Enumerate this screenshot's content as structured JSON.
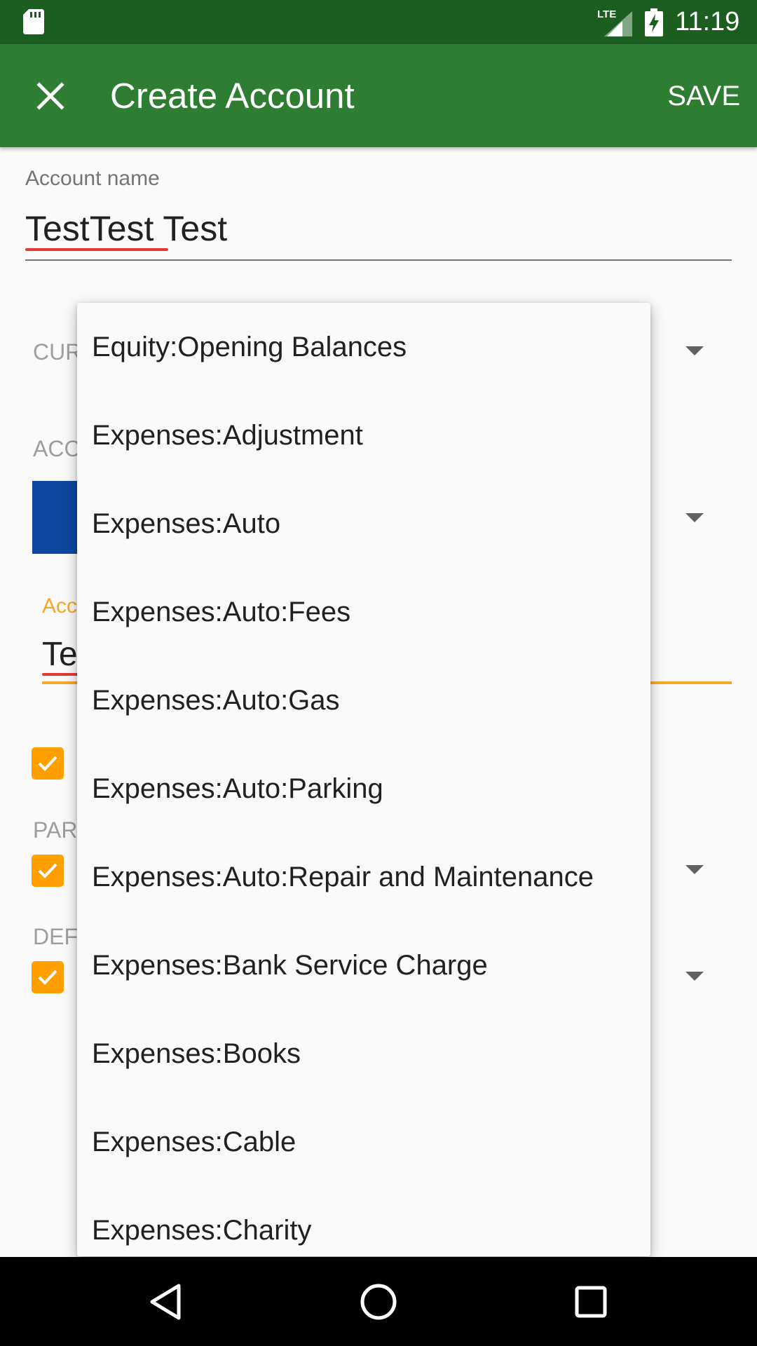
{
  "status_bar": {
    "time": "11:19",
    "network": "LTE",
    "icons": [
      "sd-card-icon",
      "lte-signal-icon",
      "battery-charging-icon"
    ]
  },
  "app_bar": {
    "title": "Create Account",
    "save_label": "SAVE",
    "close_icon": "close-icon",
    "background": "#2e7d32",
    "status_background": "#1b5e20"
  },
  "form": {
    "account_name_label": "Account name",
    "account_name_value": "TestTest Test",
    "currency_label_partial": "CUR",
    "account_type_label_partial": "ACC",
    "description_label_partial": "Acc",
    "description_value_partial": "Te",
    "parent_label_partial": "PAR",
    "default_label_partial": "DEF",
    "swatch_color": "#0d47a1",
    "accent_color": "#ffa000"
  },
  "dropdown": {
    "items": [
      "Equity:Opening Balances",
      "Expenses:Adjustment",
      "Expenses:Auto",
      "Expenses:Auto:Fees",
      "Expenses:Auto:Gas",
      "Expenses:Auto:Parking",
      "Expenses:Auto:Repair and Maintenance",
      "Expenses:Bank Service Charge",
      "Expenses:Books",
      "Expenses:Cable",
      "Expenses:Charity"
    ]
  },
  "nav_bar": {
    "icons": [
      "back-icon",
      "home-icon",
      "recents-icon"
    ]
  }
}
